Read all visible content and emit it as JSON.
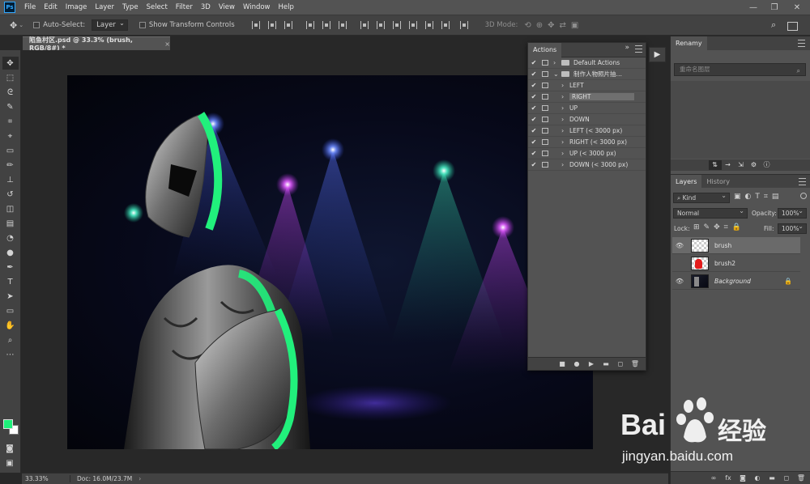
{
  "app": {
    "logo": "Ps"
  },
  "menu": [
    "File",
    "Edit",
    "Image",
    "Layer",
    "Type",
    "Select",
    "Filter",
    "3D",
    "View",
    "Window",
    "Help"
  ],
  "options": {
    "auto_select_label": "Auto-Select:",
    "auto_select_value": "Layer",
    "transform_label": "Show Transform Controls",
    "mode3d_label": "3D Mode:"
  },
  "document": {
    "tab_title": "陷鱼村区.psd @ 33.3% (brush, RGB/8#) *",
    "close": "×"
  },
  "status": {
    "zoom": "33.33%",
    "doc": "Doc: 16.0M/23.7M"
  },
  "actions_panel": {
    "title": "Actions",
    "rows": [
      {
        "label": "Default Actions",
        "checked": true,
        "level": 0,
        "folder": true
      },
      {
        "label": "制作人物照片抽…",
        "checked": true,
        "level": 0,
        "folder": true,
        "open": true
      },
      {
        "label": "LEFT",
        "checked": true,
        "level": 1
      },
      {
        "label": "RIGHT",
        "checked": true,
        "level": 1,
        "selected": true
      },
      {
        "label": "UP",
        "checked": true,
        "level": 1
      },
      {
        "label": "DOWN",
        "checked": true,
        "level": 1
      },
      {
        "label": "LEFT (< 3000 px)",
        "checked": true,
        "level": 1
      },
      {
        "label": "RIGHT (< 3000 px)",
        "checked": true,
        "level": 1
      },
      {
        "label": "UP (< 3000 px)",
        "checked": true,
        "level": 1
      },
      {
        "label": "DOWN (< 3000 px)",
        "checked": true,
        "level": 1
      }
    ]
  },
  "renamy": {
    "title": "Renamy",
    "placeholder": "重命名图层"
  },
  "layers_panel": {
    "tabs": [
      "Layers",
      "History"
    ],
    "kind_label": "Kind",
    "blend_mode": "Normal",
    "opacity_label": "Opacity:",
    "opacity_value": "100%",
    "lock_label": "Lock:",
    "fill_label": "Fill:",
    "fill_value": "100%",
    "layers": [
      {
        "name": "brush",
        "visible": true,
        "selected": true,
        "thumb": "checker"
      },
      {
        "name": "brush2",
        "visible": false,
        "selected": false,
        "thumb": "red"
      },
      {
        "name": "Background",
        "visible": true,
        "selected": false,
        "thumb": "dark",
        "locked": true
      }
    ]
  },
  "watermark": {
    "brand_latin": "Bai",
    "brand_cn": "经验",
    "url": "jingyan.baidu.com"
  },
  "colors": {
    "foreground": "#1ef07a",
    "background": "#ffffff",
    "accent": "#31a8ff"
  }
}
